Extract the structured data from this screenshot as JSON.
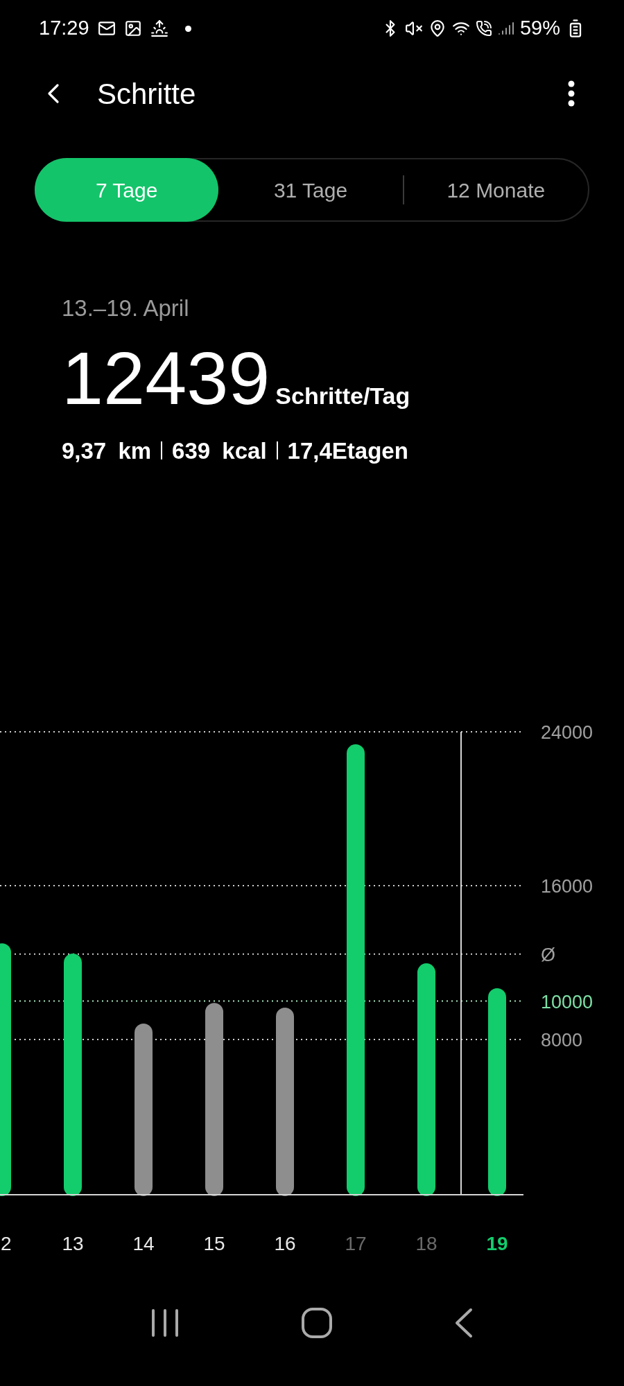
{
  "status_bar": {
    "time": "17:29",
    "battery": "59%"
  },
  "header": {
    "title": "Schritte"
  },
  "tabs": [
    {
      "label": "7 Tage",
      "selected": true
    },
    {
      "label": "31 Tage",
      "selected": false
    },
    {
      "label": "12 Monate",
      "selected": false
    }
  ],
  "summary": {
    "date_range": "13.–19. April",
    "steps": "12439",
    "unit": "Schritte/Tag",
    "stats": [
      "9,37 km",
      "639 kcal",
      "17,4Etagen"
    ]
  },
  "chart": {
    "chart_data": {
      "type": "bar",
      "categories": [
        "2",
        "13",
        "14",
        "15",
        "16",
        "17",
        "18",
        "19"
      ],
      "series": [
        {
          "color": "#13cc6c",
          "values": [
            13000,
            12470,
            null,
            null,
            null,
            23350,
            11960,
            10670
          ]
        },
        {
          "color": "#8e8e8e",
          "values": [
            null,
            null,
            8830,
            9900,
            9660,
            null,
            null,
            null
          ]
        }
      ],
      "ylim": [
        0,
        24000
      ],
      "yticks": [
        8000,
        10000,
        {
          "value": 12439,
          "label": "Ø"
        },
        16000,
        24000
      ],
      "grid": true,
      "ref_lines": [
        {
          "axis": "y",
          "value": 10000,
          "color": "#a9e7c0"
        }
      ]
    },
    "days": [
      {
        "dim": false,
        "selected": false
      },
      {
        "dim": false,
        "selected": false
      },
      {
        "dim": false,
        "selected": false
      },
      {
        "dim": false,
        "selected": false
      },
      {
        "dim": false,
        "selected": false
      },
      {
        "dim": true,
        "selected": false
      },
      {
        "dim": true,
        "selected": false
      },
      {
        "dim": false,
        "selected": true
      }
    ]
  }
}
